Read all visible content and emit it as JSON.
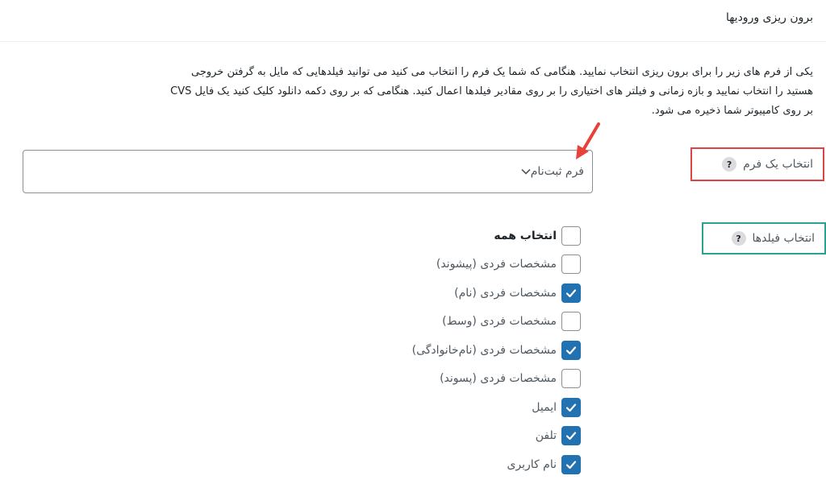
{
  "header": {
    "title": "برون ریزی ورودیها"
  },
  "description": {
    "line1": "یکی از فرم های زیر را برای برون ریزی انتخاب نمایید. هنگامی که شما یک فرم را انتخاب می کنید می توانید فیلدهایی که مایل به گرفتن خروجی",
    "line2": "هستید را انتخاب نمایید و بازه زمانی و فیلتر های اختیاری را بر روی مقادیر فیلدها اعمال کنید. هنگامی که بر روی دکمه دانلود کلیک کنید یک فایل CVS",
    "line3": "بر روی کامپیوتر شما ذخیره می شود."
  },
  "form_select": {
    "label": "انتخاب یک فرم",
    "help": "?",
    "value": "فرم ثبت‌نام"
  },
  "fields": {
    "label": "انتخاب فیلدها",
    "help": "?",
    "items": [
      {
        "label": "انتخاب همه",
        "checked": false,
        "bold": true
      },
      {
        "label": "مشخصات فردی (پیشوند)",
        "checked": false
      },
      {
        "label": "مشخصات فردی (نام)",
        "checked": true
      },
      {
        "label": "مشخصات فردی (وسط)",
        "checked": false
      },
      {
        "label": "مشخصات فردی (نام‌خانوادگی)",
        "checked": true
      },
      {
        "label": "مشخصات فردی (پسوند)",
        "checked": false
      },
      {
        "label": "ایمیل",
        "checked": true
      },
      {
        "label": "تلفن",
        "checked": true
      },
      {
        "label": "نام کاربری",
        "checked": true
      }
    ]
  },
  "colors": {
    "accent": "#2271b1",
    "highlight_red": "#e04343",
    "highlight_teal": "#2aa28f",
    "arrow": "#e8413a"
  }
}
